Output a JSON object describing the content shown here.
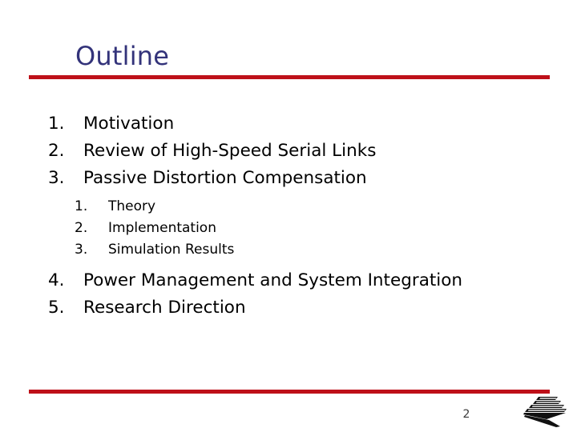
{
  "slide": {
    "title": "Outline",
    "page_number": "2",
    "colors": {
      "title": "#33337a",
      "rule": "#be1019",
      "body_text": "#000000",
      "page_number": "#3a3a3a",
      "background": "#ffffff"
    },
    "outline": [
      {
        "number": "1.",
        "text": "Motivation"
      },
      {
        "number": "2.",
        "text": "Review of High-Speed Serial Links"
      },
      {
        "number": "3.",
        "text": "Passive Distortion Compensation"
      },
      {
        "number": "4.",
        "text": "Power Management and System Integration"
      },
      {
        "number": "5.",
        "text": "Research Direction"
      }
    ],
    "sub_outline": [
      {
        "number": "1.",
        "text": "Theory"
      },
      {
        "number": "2.",
        "text": "Implementation"
      },
      {
        "number": "3.",
        "text": "Simulation Results"
      }
    ],
    "logo": {
      "name": "stacked-layers-logo"
    }
  }
}
